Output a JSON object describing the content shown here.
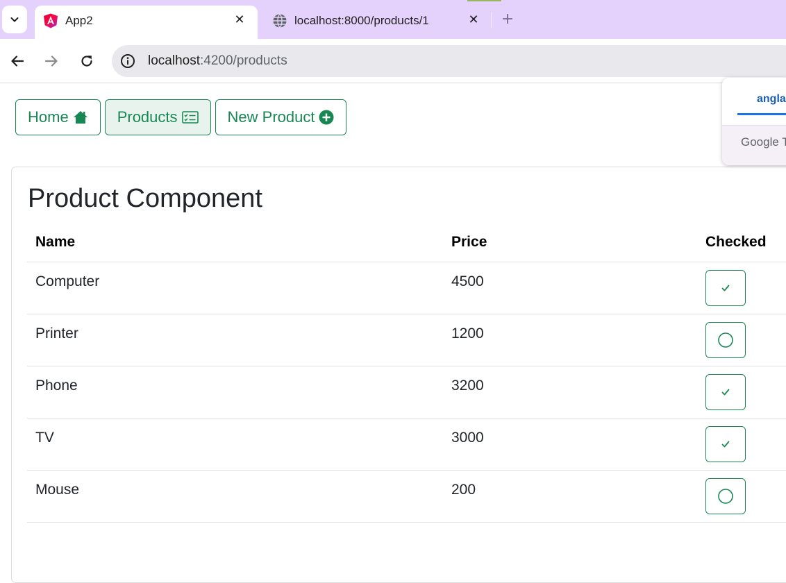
{
  "browser": {
    "tabs": [
      {
        "title": "App2",
        "icon": "angular-icon",
        "active": true
      },
      {
        "title": "localhost:8000/products/1",
        "icon": "globe-icon",
        "active": false
      }
    ],
    "omnibox": {
      "host": "localhost",
      "rest": ":4200/products"
    }
  },
  "nav": {
    "home": "Home",
    "products": "Products",
    "new_product": "New Product"
  },
  "page": {
    "title": "Product Component",
    "columns": {
      "name": "Name",
      "price": "Price",
      "checked": "Checked"
    },
    "products": [
      {
        "name": "Computer",
        "price": "4500",
        "checked": true
      },
      {
        "name": "Printer",
        "price": "1200",
        "checked": false
      },
      {
        "name": "Phone",
        "price": "3200",
        "checked": true
      },
      {
        "name": "TV",
        "price": "3000",
        "checked": true
      },
      {
        "name": "Mouse",
        "price": "200",
        "checked": false
      }
    ]
  },
  "translate_popup": {
    "lang_tab": "angla",
    "footer": "Google T"
  },
  "colors": {
    "accent": "#198754",
    "tabstrip": "#e4d2fc",
    "omnibox": "#e8e8ed"
  }
}
